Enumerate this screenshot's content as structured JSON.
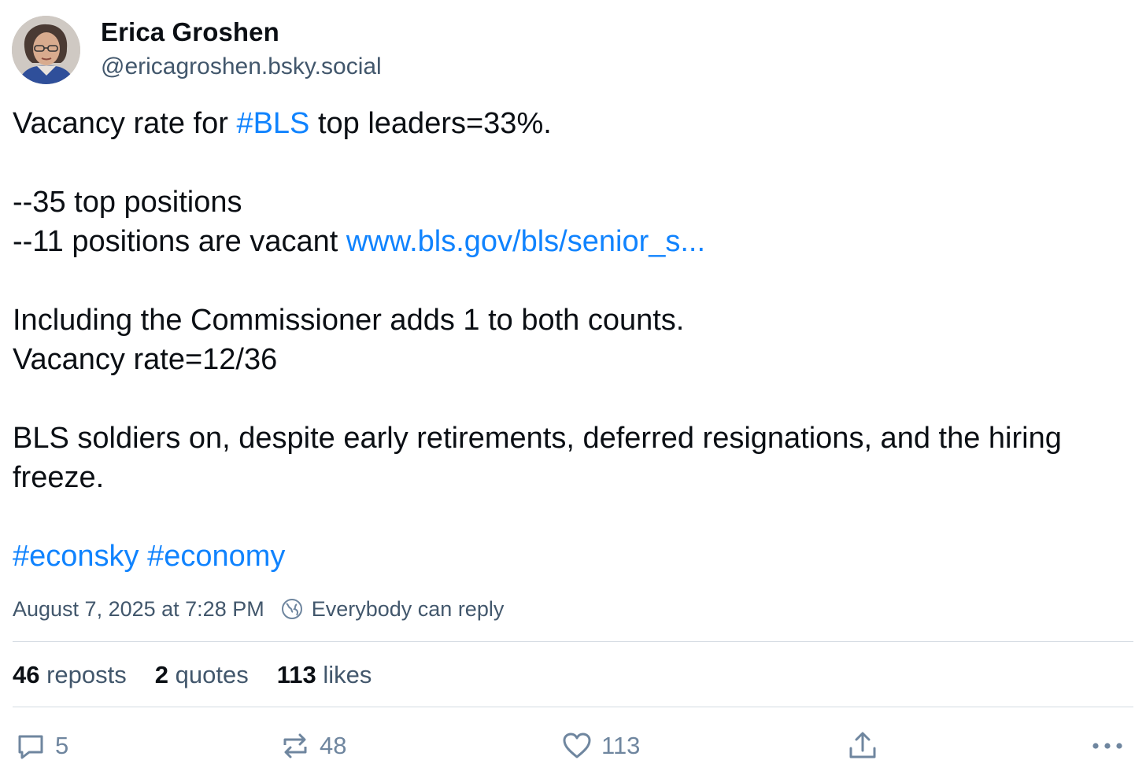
{
  "author": {
    "name": "Erica Groshen",
    "handle": "@ericagroshen.bsky.social",
    "avatar_icon": "avatar-photo"
  },
  "post": {
    "line1_prefix": "Vacancy rate for ",
    "line1_hashtag": "#BLS",
    "line1_suffix": " top leaders=33%.",
    "line2": "--35 top positions",
    "line3_prefix": "--11 positions are vacant ",
    "line3_link": "www.bls.gov/bls/senior_s...",
    "line4": "Including the Commissioner adds 1 to both counts.",
    "line5": "Vacancy rate=12/36",
    "line6": "BLS soldiers on, despite early retirements, deferred resignations, and the hiring",
    "line7": "freeze.",
    "hashtag1": "#econsky",
    "hashtag2": "#economy"
  },
  "meta": {
    "timestamp": "August 7, 2025 at 7:28 PM",
    "reply_setting": "Everybody can reply",
    "reply_setting_icon": "globe-icon"
  },
  "stats": {
    "reposts_count": "46",
    "reposts_label": "reposts",
    "quotes_count": "2",
    "quotes_label": "quotes",
    "likes_count": "113",
    "likes_label": "likes"
  },
  "actions": {
    "reply_count": "5",
    "repost_count": "48",
    "like_count": "113",
    "reply_icon": "reply-icon",
    "repost_icon": "repost-icon",
    "like_icon": "heart-icon",
    "share_icon": "share-icon",
    "more_icon": "more-icon"
  },
  "colors": {
    "text": "#0b0f14",
    "muted": "#42576c",
    "link": "#1083fe",
    "divider": "#d4dbe2",
    "icon": "#6f869f"
  }
}
